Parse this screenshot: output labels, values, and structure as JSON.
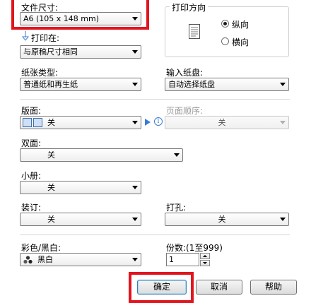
{
  "paper_size": {
    "label": "文件尺寸:",
    "value": "A6 (105 x 148 mm)"
  },
  "print_on": {
    "label": "打印在:",
    "value": "与原稿尺寸相同"
  },
  "orientation": {
    "title": "打印方向",
    "portrait": "纵向",
    "landscape": "横向",
    "selected": "portrait"
  },
  "paper_type": {
    "label": "纸张类型:",
    "value": "普通纸和再生纸"
  },
  "input_tray": {
    "label": "输入纸盘:",
    "value": "自动选择纸盘"
  },
  "layout": {
    "label": "版面:",
    "value": "关"
  },
  "page_order": {
    "label": "页面顺序:",
    "value": "关"
  },
  "duplex": {
    "label": "双面:",
    "value": "关"
  },
  "booklet": {
    "label": "小册:",
    "value": "关"
  },
  "staple": {
    "label": "装订:",
    "value": "关"
  },
  "punch": {
    "label": "打孔:",
    "value": "关"
  },
  "color_mode": {
    "label": "彩色/黑白:",
    "value": "黑白"
  },
  "copies": {
    "label": "份数:(1至999)",
    "value": "1"
  },
  "buttons": {
    "ok": "确定",
    "cancel": "取消",
    "help": "帮助"
  },
  "colors": {
    "highlight": "#e2141e",
    "accent": "#3a7bd5"
  }
}
